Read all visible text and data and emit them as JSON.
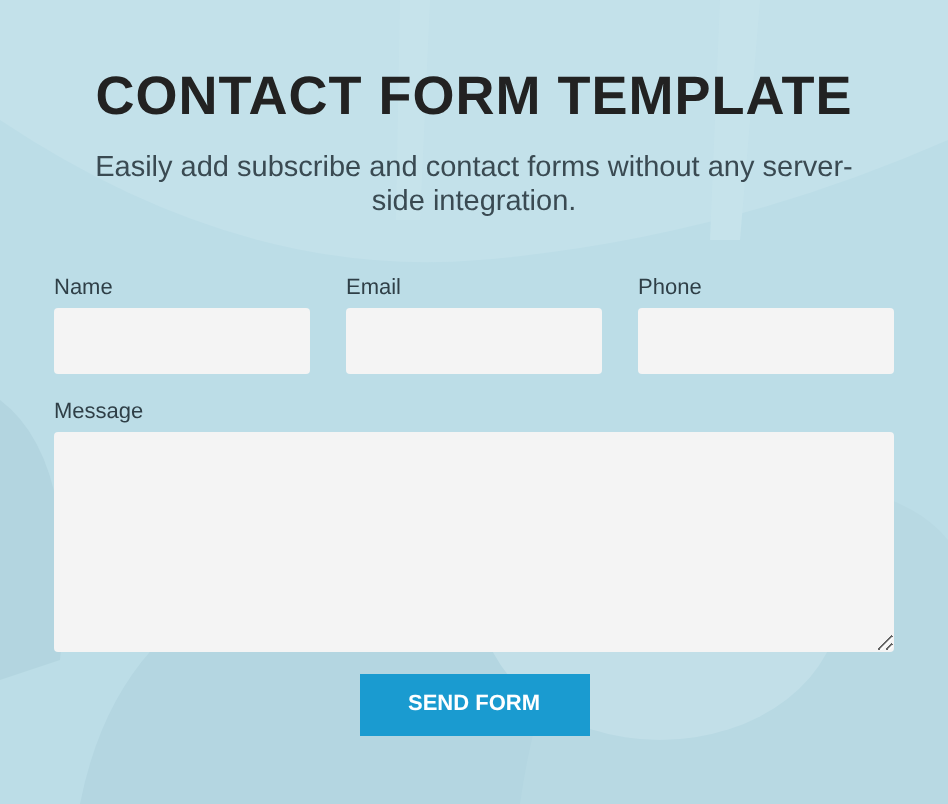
{
  "title": "CONTACT FORM TEMPLATE",
  "subtitle": "Easily add subscribe and contact forms without any server-side integration.",
  "fields": [
    {
      "label": "Name",
      "kind": "input"
    },
    {
      "label": "Email",
      "kind": "input"
    },
    {
      "label": "Phone",
      "kind": "input"
    },
    {
      "label": "Message",
      "kind": "textarea"
    }
  ],
  "submit_button": "SEND FORM"
}
